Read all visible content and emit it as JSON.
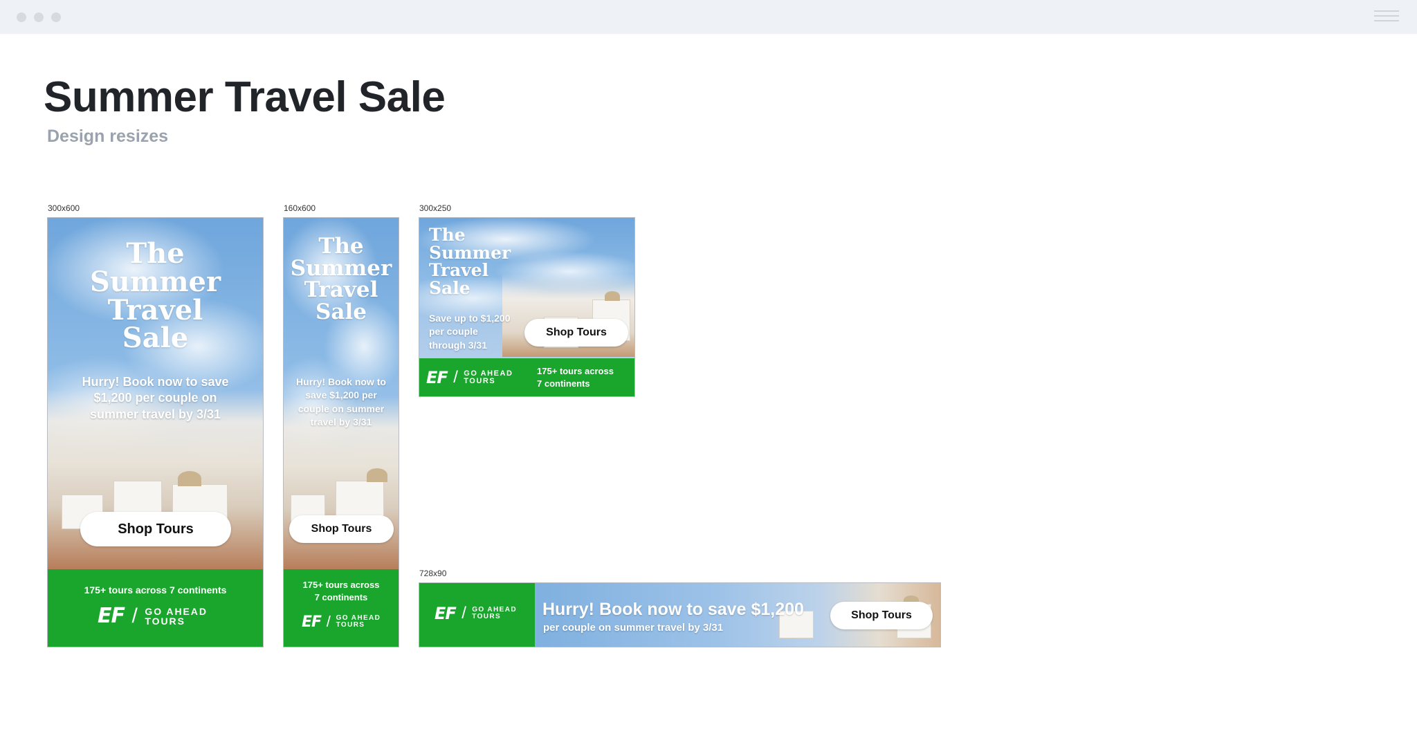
{
  "window": {
    "title": ""
  },
  "page": {
    "title": "Summer Travel Sale",
    "subtitle": "Design resizes"
  },
  "colors": {
    "green": "#1aa52c",
    "sky": "#8dbbe6",
    "title_text": "#212529",
    "subtitle_text": "#9aa3ad"
  },
  "ads": {
    "tall": {
      "size": "300x600",
      "headline": [
        "The",
        "Summer",
        "Travel",
        "Sale"
      ],
      "body": [
        "Hurry! Book now to save",
        "$1,200 per couple on",
        "summer travel by 3/31"
      ],
      "button": "Shop Tours",
      "tours": "175+ tours across 7 continents",
      "logo": {
        "ef": "EF",
        "line1": "GO AHEAD",
        "line2": "TOURS"
      }
    },
    "skinny": {
      "size": "160x600",
      "headline": [
        "The",
        "Summer",
        "Travel",
        "Sale"
      ],
      "body": [
        "Hurry! Book now to",
        "save $1,200 per",
        "couple on summer",
        "travel by 3/31"
      ],
      "button": "Shop Tours",
      "tours": [
        "175+ tours across",
        "7 continents"
      ],
      "logo": {
        "ef": "EF",
        "line1": "GO AHEAD",
        "line2": "TOURS"
      }
    },
    "square": {
      "size": "300x250",
      "headline": [
        "The",
        "Summer",
        "Travel",
        "Sale"
      ],
      "body": [
        "Save up to $1,200",
        "per couple",
        "through 3/31"
      ],
      "button": "Shop Tours",
      "tours": [
        "175+ tours across",
        "7 continents"
      ],
      "logo": {
        "ef": "EF",
        "line1": "GO AHEAD",
        "line2": "TOURS"
      }
    },
    "leader": {
      "size": "728x90",
      "headline": "Hurry! Book now to save $1,200",
      "body": "per couple on summer travel by 3/31",
      "button": "Shop Tours",
      "logo": {
        "ef": "EF",
        "line1": "GO AHEAD",
        "line2": "TOURS"
      }
    }
  }
}
